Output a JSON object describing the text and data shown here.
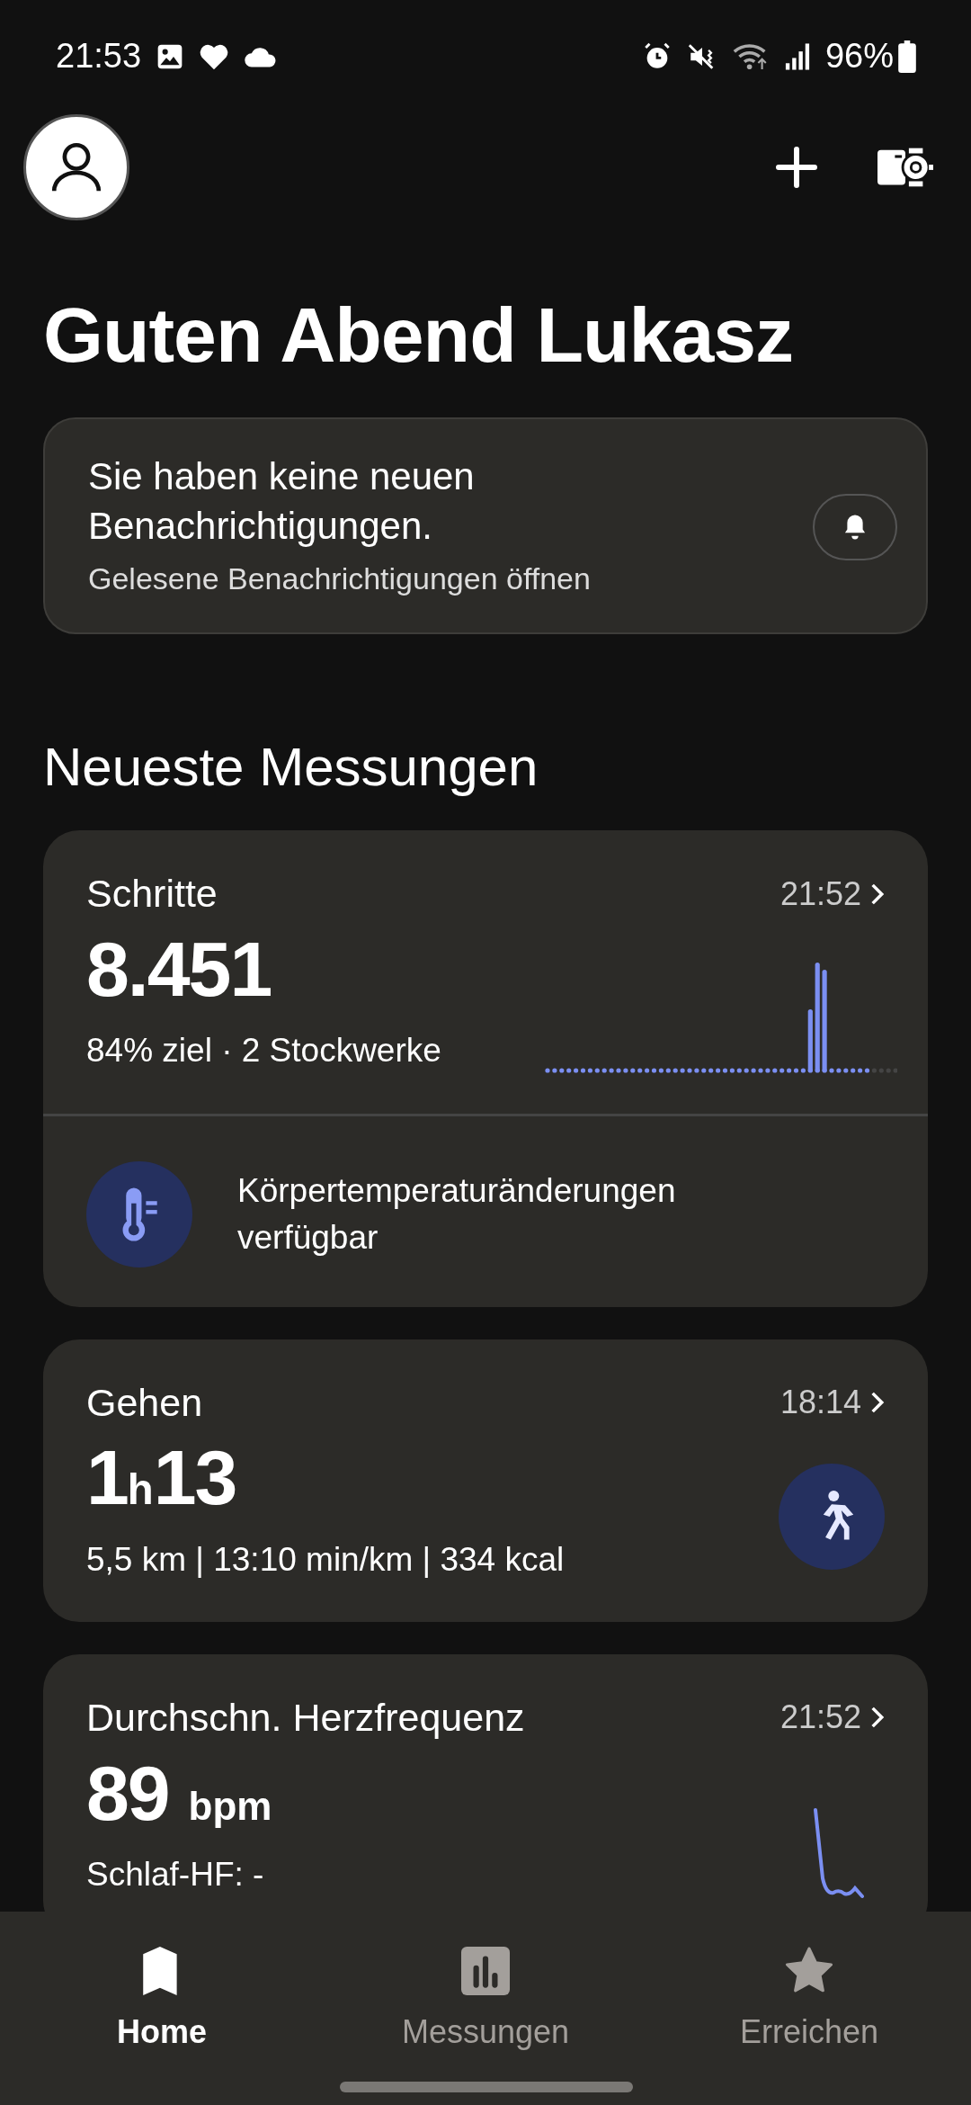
{
  "status_bar": {
    "time": "21:53",
    "battery": "96%"
  },
  "greeting": "Guten Abend Lukasz",
  "notifications": {
    "message": "Sie haben keine neuen Benachrichtigungen.",
    "link": "Gelesene Benachrichtigungen öffnen"
  },
  "section_title": "Neueste Messungen",
  "cards": [
    {
      "kind": "steps",
      "title": "Schritte",
      "time": "21:52",
      "value": "8.451",
      "detail": "84% ziel · 2 Stockwerke",
      "footer": "Körpertemperaturänderungen verfügbar"
    },
    {
      "kind": "activity",
      "title": "Gehen",
      "time": "18:14",
      "value": "1$_{h}$13",
      "detail": "5,5 km | 13:10 min/km | 334 kcal"
    },
    {
      "kind": "heart",
      "title": "Durchschn. Herzfrequenz",
      "time": "21:52",
      "value": "89",
      "unit": "bpm",
      "detail": "Schlaf-HF: -"
    }
  ],
  "bottom_nav": [
    {
      "label": "Home",
      "selected": true
    },
    {
      "label": "Messungen",
      "selected": false
    },
    {
      "label": "Erreichen",
      "selected": false
    }
  ]
}
